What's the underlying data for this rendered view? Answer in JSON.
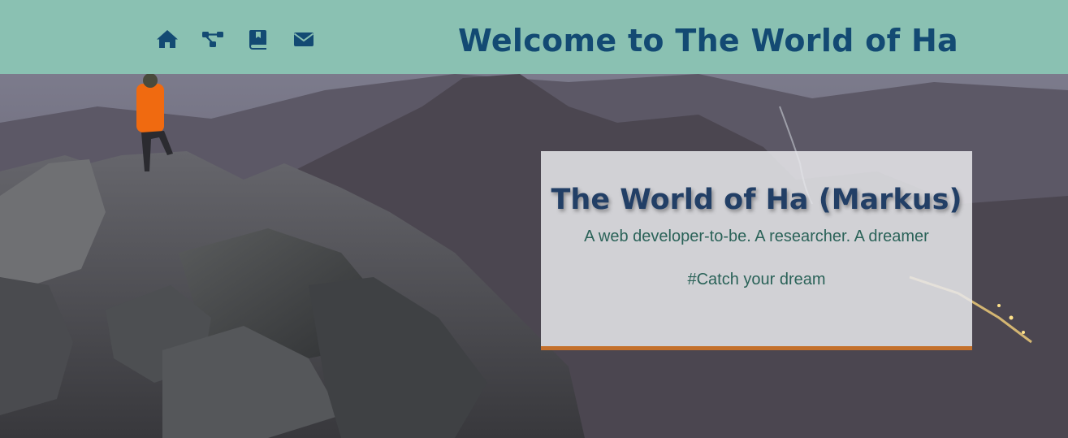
{
  "navbar": {
    "icons": [
      {
        "name": "home-icon",
        "label": "Home"
      },
      {
        "name": "share-nodes-icon",
        "label": "Projects"
      },
      {
        "name": "book-icon",
        "label": "Blog"
      },
      {
        "name": "envelope-icon",
        "label": "Contact"
      }
    ],
    "title": "Welcome to The World of Ha",
    "colors": {
      "background": "#8ac1b2",
      "icon": "#134a73",
      "title": "#134a73"
    }
  },
  "hero": {
    "background_image": "mountain-ridge-hiker-photo",
    "card": {
      "title": "The World of Ha (Markus)",
      "tagline": "A web developer-to-be. A researcher. A dreamer",
      "motto": "#Catch your dream",
      "accent_color": "#c4702b"
    }
  }
}
